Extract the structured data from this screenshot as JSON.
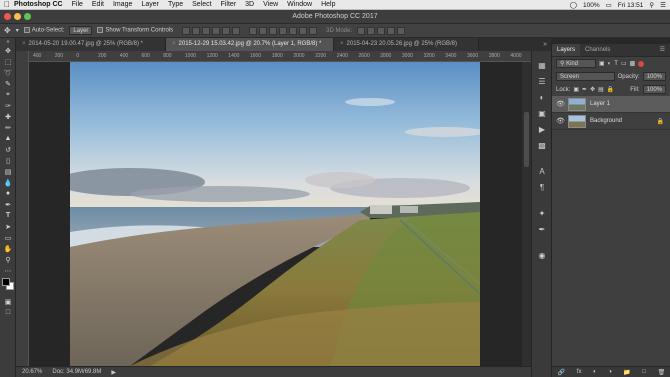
{
  "menubar": {
    "app": "Photoshop CC",
    "items": [
      "File",
      "Edit",
      "Image",
      "Layer",
      "Type",
      "Select",
      "Filter",
      "3D",
      "View",
      "Window",
      "Help"
    ],
    "battery": "100%",
    "clock": "Fri 13:51"
  },
  "window": {
    "title": "Adobe Photoshop CC 2017"
  },
  "options": {
    "auto_select": "Auto-Select:",
    "target": "Layer",
    "transform": "Show Transform Controls",
    "mode3d": "3D Mode:"
  },
  "tabs": [
    {
      "label": "2014-05-20 19.00.47.jpg @ 25% (RGB/8) *"
    },
    {
      "label": "2015-12-29 15.03.42.jpg @ 20.7% (Layer 1, RGB/8) *"
    },
    {
      "label": "2015-04-23 20.05.26.jpg @ 25% (RGB/8)"
    }
  ],
  "ruler": [
    "400",
    "200",
    "0",
    "200",
    "400",
    "600",
    "800",
    "1000",
    "1200",
    "1400",
    "1600",
    "1800",
    "2000",
    "2200",
    "2400",
    "2600",
    "2800",
    "3000",
    "3200",
    "3400",
    "3600",
    "3800",
    "4000",
    "4200"
  ],
  "status": {
    "zoom": "20.67%",
    "doc": "Doc: 34.9M/69.8M"
  },
  "layers_panel": {
    "tabs": [
      "Layers",
      "Channels"
    ],
    "kind": "Kind",
    "blend": "Screen",
    "opacity_label": "Opacity:",
    "opacity": "100%",
    "lock_label": "Lock:",
    "fill_label": "Fill:",
    "fill": "100%",
    "layers": [
      {
        "name": "Layer 1",
        "selected": true
      },
      {
        "name": "Background",
        "selected": false
      }
    ],
    "footer": [
      "fx"
    ]
  },
  "colors": {
    "accent": "#4a90d9",
    "panel": "#3f3f3f",
    "canvas_bg": "#262626"
  }
}
